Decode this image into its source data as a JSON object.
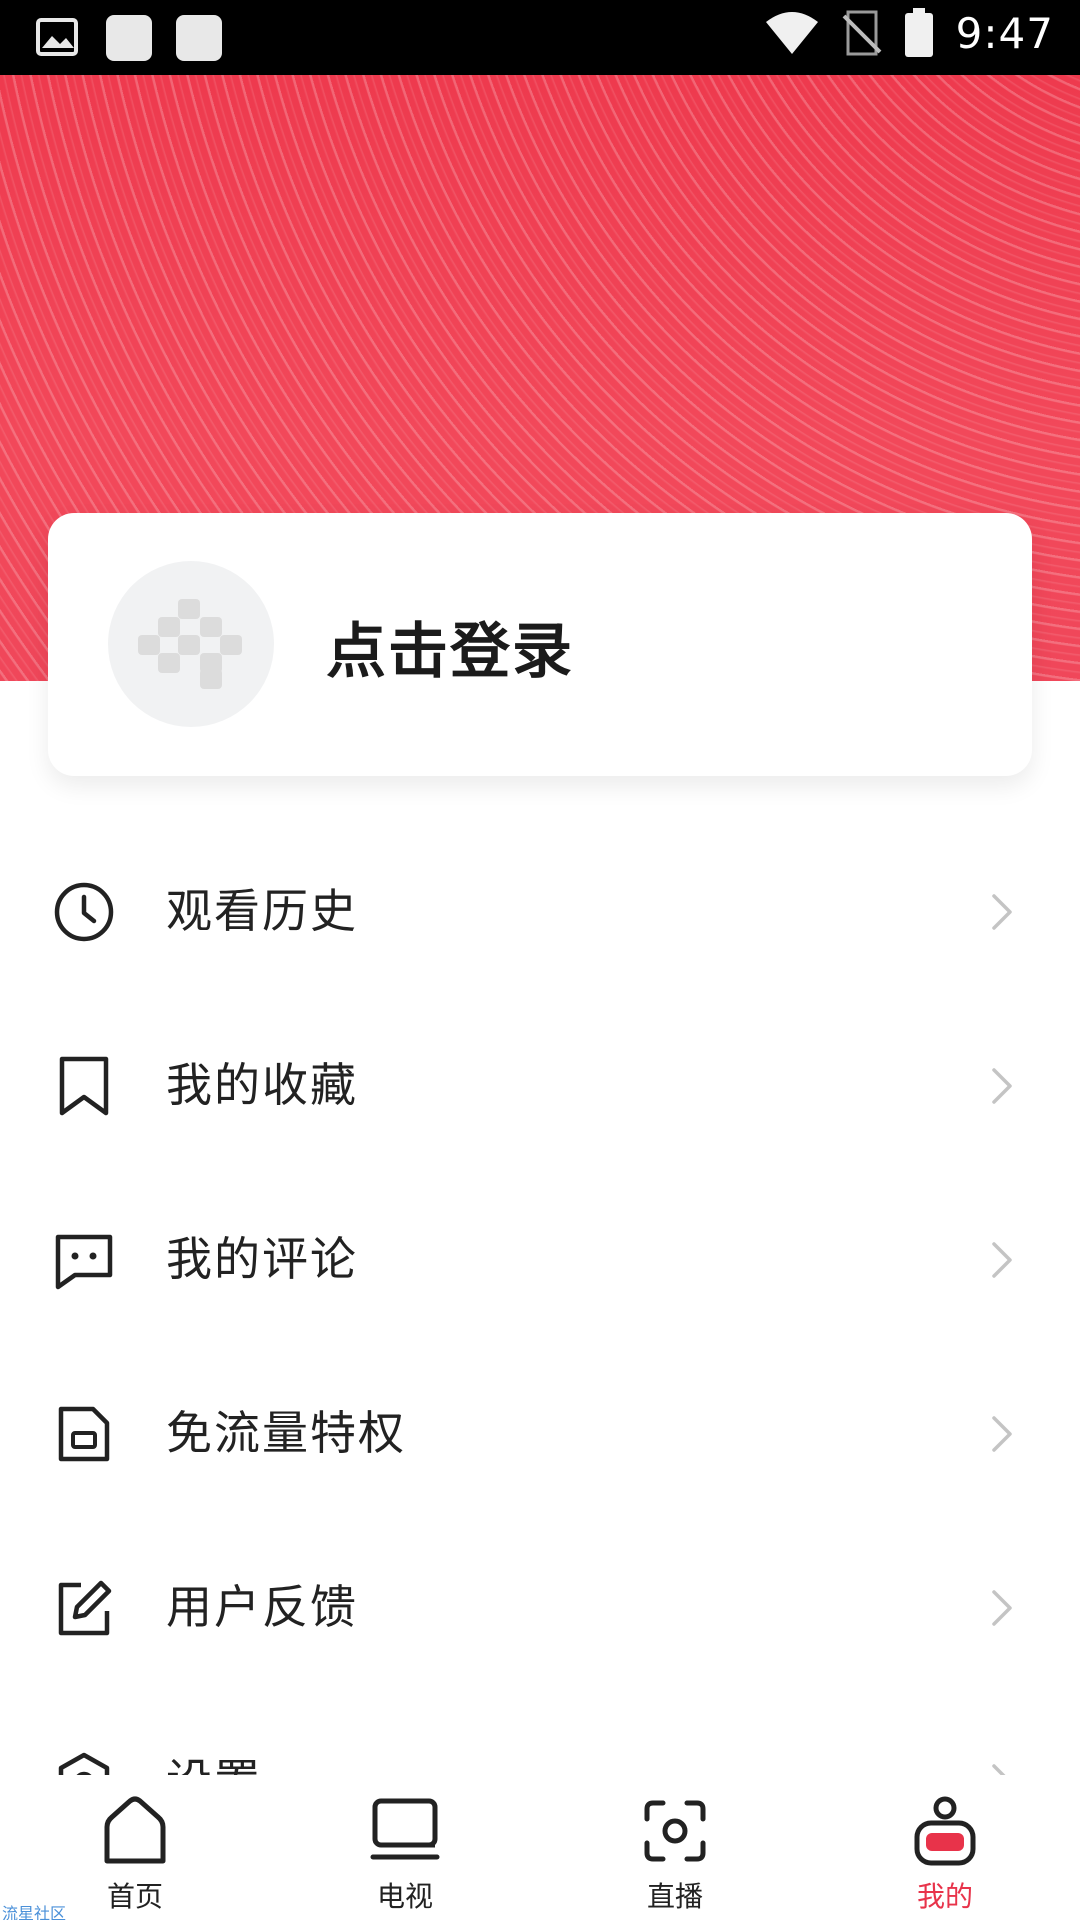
{
  "status_bar": {
    "time": "9:47",
    "icons": [
      "image-notification-icon",
      "notification-square-icon",
      "notification-square-icon",
      "wifi-icon",
      "no-signal-icon",
      "battery-icon"
    ]
  },
  "profile": {
    "login_label": "点击登录",
    "avatar_icon": "default-avatar-icon"
  },
  "menu": {
    "items": [
      {
        "label": "观看历史",
        "icon": "clock-icon"
      },
      {
        "label": "我的收藏",
        "icon": "bookmark-icon"
      },
      {
        "label": "我的评论",
        "icon": "comment-icon"
      },
      {
        "label": "免流量特权",
        "icon": "sim-card-icon"
      },
      {
        "label": "用户反馈",
        "icon": "edit-icon"
      },
      {
        "label": "设置",
        "icon": "settings-icon"
      }
    ]
  },
  "bottom_nav": {
    "items": [
      {
        "label": "首页",
        "icon": "home-icon"
      },
      {
        "label": "电视",
        "icon": "tv-icon"
      },
      {
        "label": "直播",
        "icon": "live-icon"
      },
      {
        "label": "我的",
        "icon": "profile-icon",
        "active": true
      }
    ]
  },
  "watermark": "流星社区",
  "colors": {
    "accent": "#e8334a",
    "banner": "#f0475a"
  }
}
